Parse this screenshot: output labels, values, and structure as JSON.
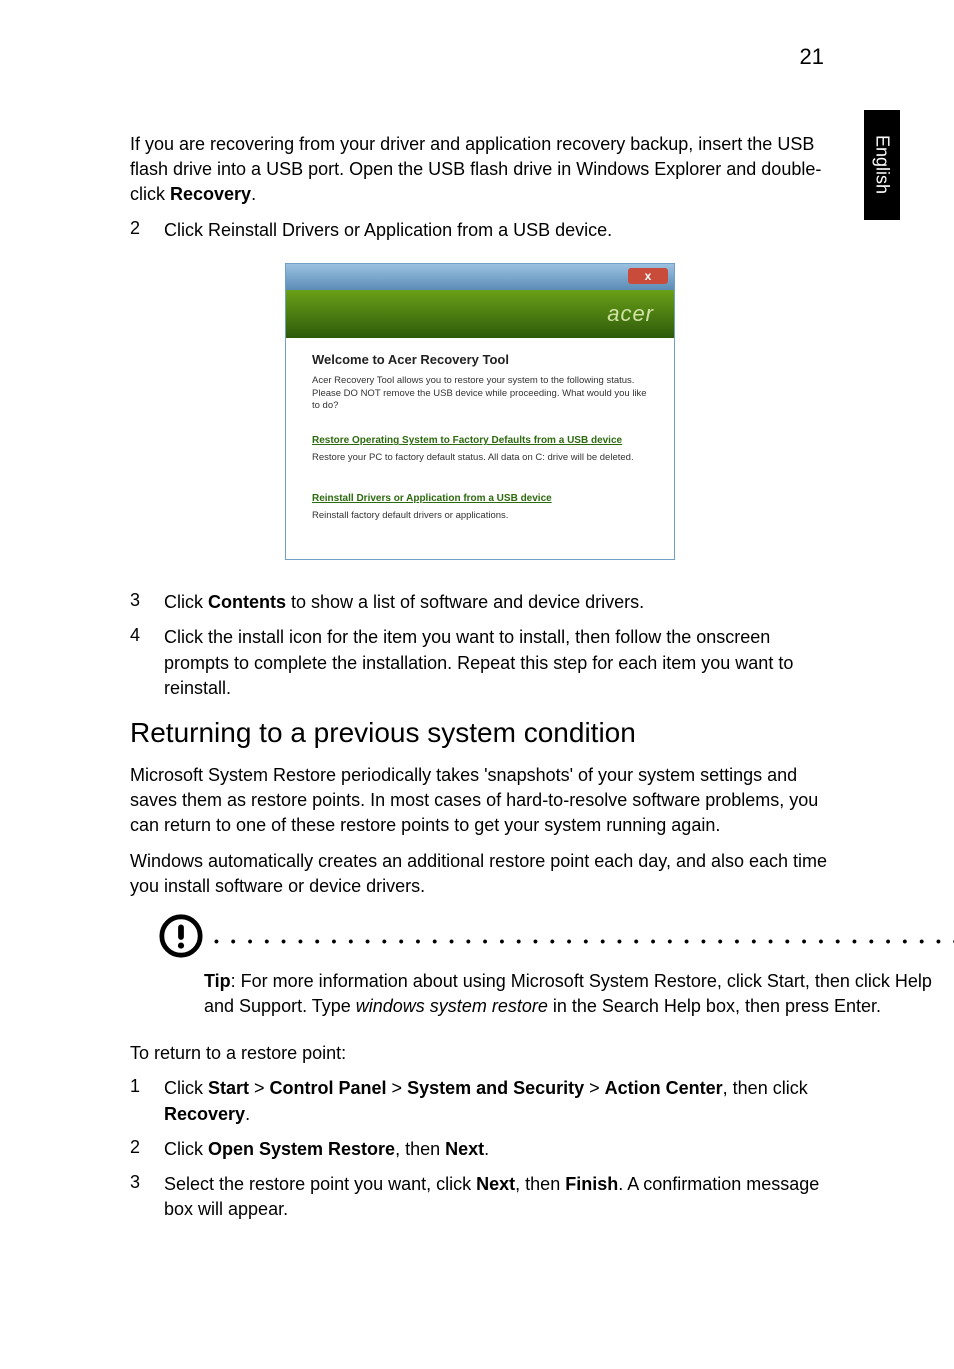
{
  "page_number": "21",
  "side_tab": "English",
  "intro_para": "If you are recovering from your driver and application recovery backup, insert the USB flash drive into a USB port. Open the USB flash drive in Windows Explorer and double-click ",
  "intro_bold": "Recovery",
  "intro_end": ".",
  "step2_num": "2",
  "step2_text": "Click Reinstall Drivers or Application from a USB device.",
  "screenshot": {
    "close": "x",
    "logo": "acer",
    "welcome": "Welcome to Acer Recovery Tool",
    "desc": "Acer Recovery Tool allows you to restore your system to the following status. Please DO NOT remove the USB device while proceeding. What would you like to do?",
    "link1": "Restore Operating System to Factory Defaults from a USB device",
    "sub1": "Restore your PC to factory default status. All data on C: drive will be deleted.",
    "link2": "Reinstall Drivers or Application from a USB device",
    "sub2": "Reinstall factory default drivers or applications."
  },
  "step3_num": "3",
  "step3_a": "Click ",
  "step3_b": "Contents",
  "step3_c": " to show a list of software and device drivers.",
  "step4_num": "4",
  "step4_text": "Click the install icon for the item you want to install, then follow the onscreen prompts to complete the installation. Repeat this step for each item you want to reinstall.",
  "heading": "Returning to a previous system condition",
  "para1": "Microsoft System Restore periodically takes 'snapshots' of your system settings and saves them as restore points. In most cases of hard-to-resolve software problems, you can return to one of these restore points to get your system running again.",
  "para2": "Windows automatically creates an additional restore point each day, and also each time you install software or device drivers.",
  "tip_a": "Tip",
  "tip_b": ": For more information about using Microsoft System Restore, click Start, then click Help and Support. Type ",
  "tip_c": "windows system restore",
  "tip_d": " in the Search Help box, then press Enter.",
  "returnline": "To return to a restore point:",
  "r1_num": "1",
  "r1_a": "Click ",
  "r1_b": "Start",
  "r1_c": "  > ",
  "r1_d": "Control Panel",
  "r1_e": " > ",
  "r1_f": "System and Security",
  "r1_g": " > ",
  "r1_h": "Action Center",
  "r1_i": ", then click ",
  "r1_j": "Recovery",
  "r1_k": ".",
  "r2_num": "2",
  "r2_a": "Click ",
  "r2_b": "Open System Restore",
  "r2_c": ", then ",
  "r2_d": "Next",
  "r2_e": ".",
  "r3_num": "3",
  "r3_a": "Select the restore point you want, click ",
  "r3_b": "Next",
  "r3_c": ", then ",
  "r3_d": "Finish",
  "r3_e": ". A confirmation message box will appear."
}
